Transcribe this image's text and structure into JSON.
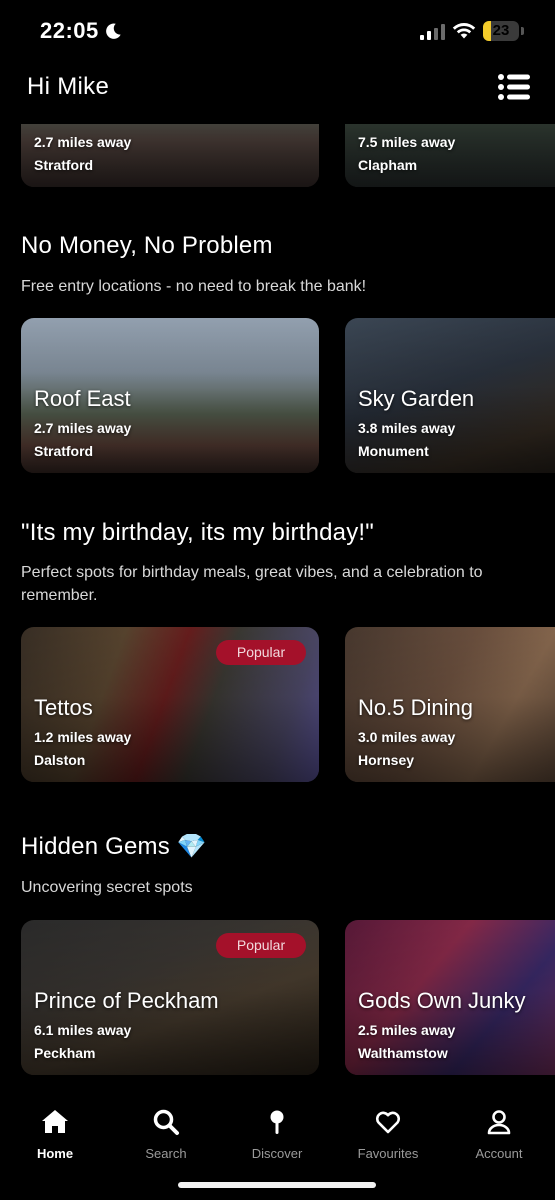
{
  "status_bar": {
    "time": "22:05",
    "battery": "23",
    "battery_level": 0.23
  },
  "header": {
    "greeting": "Hi Mike",
    "menu_icon": "list-menu-icon"
  },
  "top_row": [
    {
      "distance": "2.7 miles away",
      "area": "Stratford"
    },
    {
      "distance": "7.5 miles away",
      "area": "Clapham"
    }
  ],
  "sections": [
    {
      "title": "No Money, No Problem",
      "subtitle": "Free entry locations - no need to break the bank!",
      "cards": [
        {
          "name": "Roof East",
          "distance": "2.7 miles away",
          "area": "Stratford"
        },
        {
          "name": "Sky Garden",
          "distance": "3.8 miles away",
          "area": "Monument"
        }
      ]
    },
    {
      "title": "\"Its my birthday, its my birthday!\"",
      "subtitle": "Perfect spots for birthday meals, great vibes, and a celebration to remember.",
      "cards": [
        {
          "name": "Tettos",
          "distance": "1.2 miles away",
          "area": "Dalston",
          "badge": "Popular"
        },
        {
          "name": "No.5 Dining",
          "distance": "3.0 miles away",
          "area": "Hornsey"
        }
      ]
    },
    {
      "title": "Hidden Gems 💎",
      "subtitle": "Uncovering secret spots",
      "cards": [
        {
          "name": "Prince of Peckham",
          "distance": "6.1 miles away",
          "area": "Peckham",
          "badge": "Popular"
        },
        {
          "name": "Gods Own Junky",
          "distance": "2.5 miles away",
          "area": "Walthamstow"
        }
      ]
    }
  ],
  "nav": [
    {
      "label": "Home",
      "icon": "home-icon",
      "active": true
    },
    {
      "label": "Search",
      "icon": "search-icon"
    },
    {
      "label": "Discover",
      "icon": "pin-icon"
    },
    {
      "label": "Favourites",
      "icon": "heart-icon"
    },
    {
      "label": "Account",
      "icon": "user-icon"
    }
  ],
  "colors": {
    "background": "#000000",
    "badge": "#a4112a",
    "battery": "#f4cc2a",
    "nav_inactive": "#9a9a9a"
  }
}
